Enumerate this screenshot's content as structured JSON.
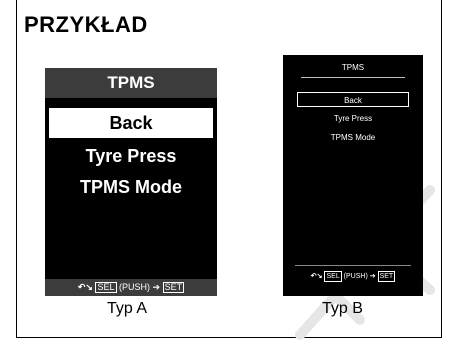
{
  "page": {
    "title": "PRZYKŁAD"
  },
  "typeA": {
    "header": "TPMS",
    "items": [
      "Back",
      "Tyre Press",
      "TPMS Mode"
    ],
    "footer": {
      "back_symbol": "↶↘",
      "sel": "SEL",
      "push": "(PUSH)",
      "arrow": "➔",
      "set": "SET"
    },
    "caption": "Typ A"
  },
  "typeB": {
    "header": "TPMS",
    "items": [
      "Back",
      "Tyre Press",
      "TPMS Mode"
    ],
    "footer": {
      "back_symbol": "↶↘",
      "sel": "SEL",
      "push": "(PUSH)",
      "arrow": "➔",
      "set": "SET"
    },
    "caption": "Typ B"
  },
  "colors": {
    "screen_bg": "#000000",
    "header_bg": "#3c3c3c",
    "text": "#ffffff"
  }
}
